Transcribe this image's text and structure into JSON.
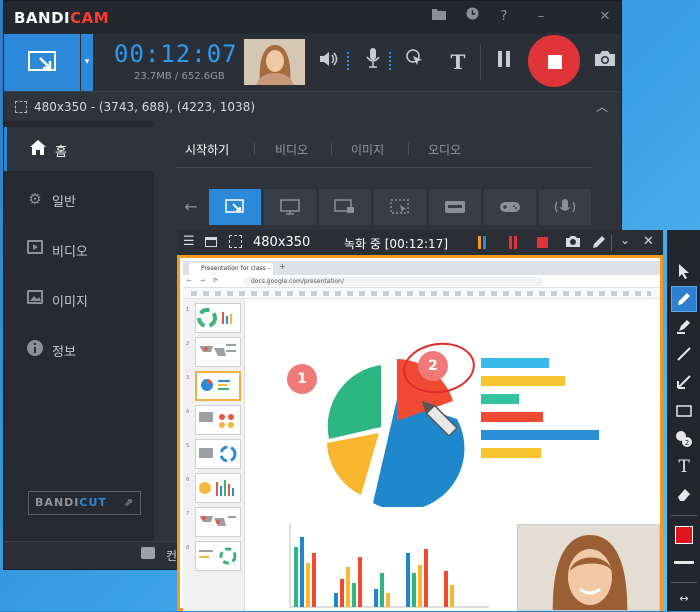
{
  "app": {
    "logo_a": "BANDI",
    "logo_b": "CAM"
  },
  "titlebar": {
    "icons": [
      "folder-icon",
      "clock-icon",
      "help-icon",
      "minimize-icon",
      "close-icon"
    ]
  },
  "toolbar": {
    "timer": "00:12:07",
    "size": "23.7MB / 652.6GB",
    "text_tool": "T"
  },
  "infobar": {
    "text": "480x350 - (3743, 688), (4223, 1038)"
  },
  "sidebar": {
    "items": [
      {
        "label": "홈",
        "icon": "home-icon"
      },
      {
        "label": "일반",
        "icon": "gear-icon"
      },
      {
        "label": "비디오",
        "icon": "video-icon"
      },
      {
        "label": "이미지",
        "icon": "image-icon"
      },
      {
        "label": "정보",
        "icon": "info-icon"
      }
    ],
    "bandicut_a": "BANDI",
    "bandicut_b": "CUT",
    "bandicut_arrow": "⇗"
  },
  "tabs": [
    "시작하기",
    "비디오",
    "이미지",
    "오디오"
  ],
  "status": {
    "text": "컨"
  },
  "recwindow": {
    "size": "480x350",
    "status": "녹화 중 [00:12:17]"
  },
  "browser": {
    "tab_title": "Presentation for class - Google",
    "url": "docs.google.com/presentation/"
  },
  "slide": {
    "badge1": "1",
    "badge2": "2"
  },
  "thumbnails": [
    "1",
    "2",
    "3",
    "4",
    "5",
    "6",
    "7",
    "8"
  ],
  "colors": {
    "accent": "#2c88d9",
    "record": "#e03438",
    "frame": "#f39a1e"
  }
}
